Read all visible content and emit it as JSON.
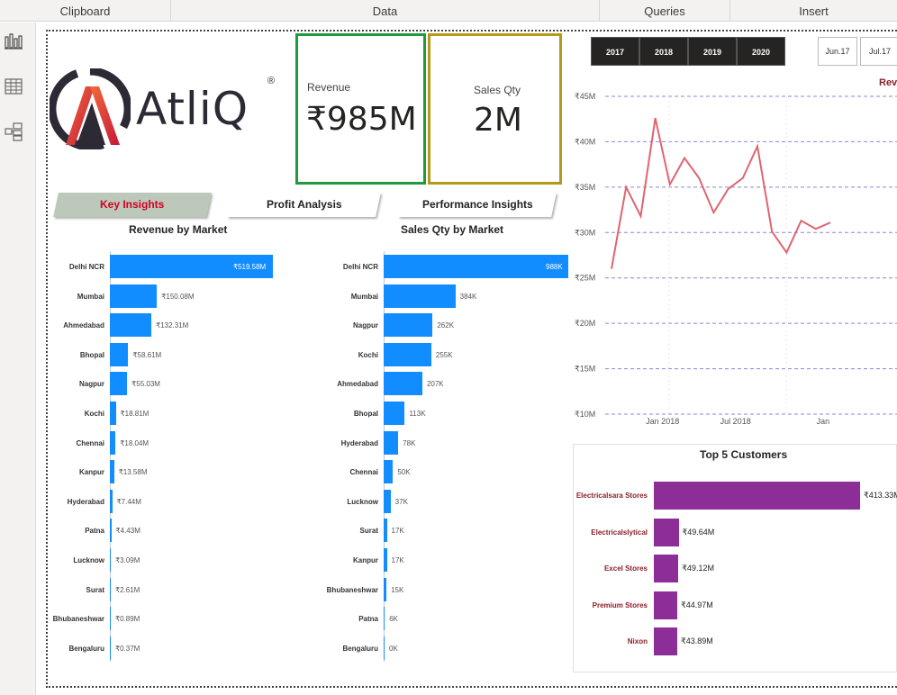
{
  "ribbon": {
    "groups": [
      "Clipboard",
      "Data",
      "Queries",
      "Insert"
    ]
  },
  "left_pane": {
    "icons": [
      "report-view-icon",
      "table-view-icon",
      "model-view-icon"
    ]
  },
  "logo": {
    "text": "AtliQ",
    "reg": "®"
  },
  "kpis": {
    "revenue": {
      "label": "Revenue",
      "value": "₹985M"
    },
    "sales_qty": {
      "label": "Sales Qty",
      "value": "2M"
    }
  },
  "year_slicer": [
    "2017",
    "2018",
    "2019",
    "2020"
  ],
  "month_slicer": [
    "Jun.17",
    "Jul.17"
  ],
  "tabs": {
    "key_insights": "Key Insights",
    "profit_analysis": "Profit Analysis",
    "performance_insights": "Performance Insights"
  },
  "colors": {
    "bar_blue": "#118dff",
    "customer_purple": "#8d2e98",
    "revenue_border": "#1e9b3a",
    "qty_border": "#b59a17",
    "trend_line": "#e06470",
    "active_tab_text": "#d40024"
  },
  "chart_data": [
    {
      "type": "bar",
      "orientation": "horizontal",
      "title": "Revenue by Market",
      "categories": [
        "Delhi NCR",
        "Mumbai",
        "Ahmedabad",
        "Bhopal",
        "Nagpur",
        "Kochi",
        "Chennai",
        "Kanpur",
        "Hyderabad",
        "Patna",
        "Lucknow",
        "Surat",
        "Bhubaneshwar",
        "Bengaluru"
      ],
      "values": [
        519.58,
        150.08,
        132.31,
        58.61,
        55.03,
        18.81,
        18.04,
        13.58,
        7.44,
        4.43,
        3.09,
        2.61,
        0.89,
        0.37
      ],
      "labels": [
        "₹519.58M",
        "₹150.08M",
        "₹132.31M",
        "₹58.61M",
        "₹55.03M",
        "₹18.81M",
        "₹18.04M",
        "₹13.58M",
        "₹7.44M",
        "₹4.43M",
        "₹3.09M",
        "₹2.61M",
        "₹0.89M",
        "₹0.37M"
      ]
    },
    {
      "type": "bar",
      "orientation": "horizontal",
      "title": "Sales Qty by Market",
      "categories": [
        "Delhi NCR",
        "Mumbai",
        "Nagpur",
        "Kochi",
        "Ahmedabad",
        "Bhopal",
        "Hyderabad",
        "Chennai",
        "Lucknow",
        "Surat",
        "Kanpur",
        "Bhubaneshwar",
        "Patna",
        "Bengaluru"
      ],
      "values": [
        988,
        384,
        262,
        255,
        207,
        113,
        78,
        50,
        37,
        17,
        17,
        15,
        6,
        0
      ],
      "labels": [
        "988K",
        "384K",
        "262K",
        "255K",
        "207K",
        "113K",
        "78K",
        "50K",
        "37K",
        "17K",
        "17K",
        "15K",
        "6K",
        "0K"
      ]
    },
    {
      "type": "line",
      "title": "Rev",
      "x_tick_labels": [
        "Jan 2018",
        "Jul 2018",
        "Jan"
      ],
      "y_tick_labels": [
        "₹45M",
        "₹40M",
        "₹35M",
        "₹30M",
        "₹25M",
        "₹20M",
        "₹15M",
        "₹10M"
      ],
      "ylim": [
        10,
        45
      ],
      "y_ticks": [
        45,
        40,
        35,
        30,
        25,
        20,
        15,
        10
      ],
      "values": [
        26.0,
        35.0,
        31.8,
        42.6,
        35.3,
        38.2,
        36.0,
        32.2,
        34.8,
        36.0,
        39.5,
        30.1,
        27.8,
        31.3,
        30.4,
        31.1
      ],
      "x_tick_positions": [
        3.5,
        8.5,
        14.5
      ],
      "grid": "horizontal dashed"
    },
    {
      "type": "bar",
      "orientation": "horizontal",
      "title": "Top 5 Customers",
      "categories": [
        "Electricalsara Stores",
        "Electricalslytical",
        "Excel Stores",
        "Premium Stores",
        "Nixon"
      ],
      "values": [
        413.33,
        49.64,
        49.12,
        44.97,
        43.89
      ],
      "labels": [
        "₹413.33M",
        "₹49.64M",
        "₹49.12M",
        "₹44.97M",
        "₹43.89M"
      ]
    }
  ]
}
